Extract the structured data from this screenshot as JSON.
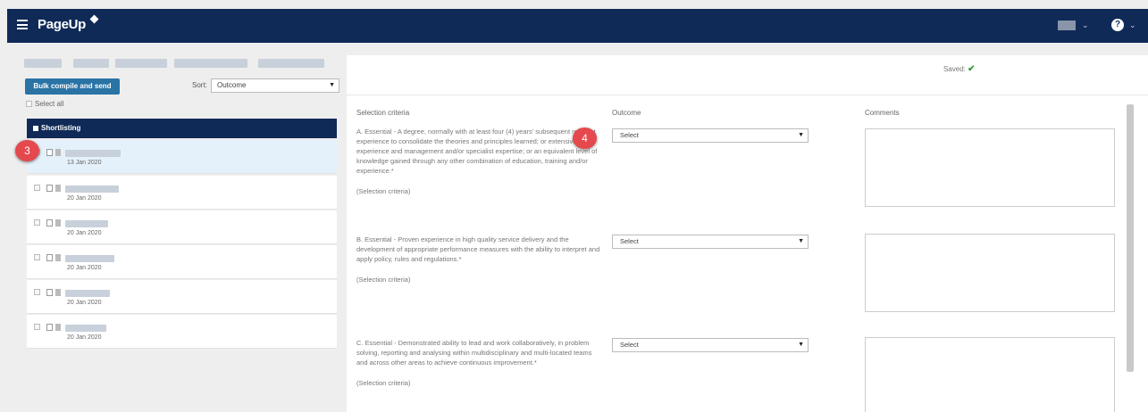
{
  "header": {
    "logo": "PageUp",
    "help_glyph": "?",
    "icons": [
      "menu-icon",
      "user-menu",
      "chevron-down-icon",
      "help-icon"
    ]
  },
  "sidebar": {
    "bulk_button": "Bulk compile and send",
    "sort_label": "Sort:",
    "sort_value": "Outcome",
    "select_all": "Select all",
    "group_title": "Shortlisting",
    "candidates": [
      {
        "date": "13 Jan 2020",
        "active": true
      },
      {
        "date": "20 Jan 2020"
      },
      {
        "date": "20 Jan 2020"
      },
      {
        "date": "20 Jan 2020"
      },
      {
        "date": "20 Jan 2020"
      },
      {
        "date": "20 Jan 2020"
      }
    ]
  },
  "annotations": {
    "step3": "3",
    "step4": "4"
  },
  "main": {
    "saved_label": "Saved:",
    "columns": {
      "criteria": "Selection criteria",
      "outcome": "Outcome",
      "comments": "Comments"
    },
    "criteria": [
      {
        "text": "A. Essential - A degree, normally with at least four (4) years' subsequent relevant experience to consolidate the theories and principles learned; or extensive experience and management and/or specialist expertise; or an equivalent level of knowledge gained through any other combination of education, training and/or experience.*",
        "source": "(Selection criteria)",
        "outcome": "Select"
      },
      {
        "text": "B. Essential - Proven experience in high quality service delivery and the development of appropriate performance measures with the ability to interpret and apply policy, rules and regulations.*",
        "source": "(Selection criteria)",
        "outcome": "Select"
      },
      {
        "text": "C. Essential - Demonstrated ability to lead and work collaboratively, in problem solving, reporting and analysing within multidisciplinary and multi-located teams and across other areas to achieve continuous improvement.*",
        "source": "(Selection criteria)",
        "outcome": "Select"
      }
    ]
  }
}
